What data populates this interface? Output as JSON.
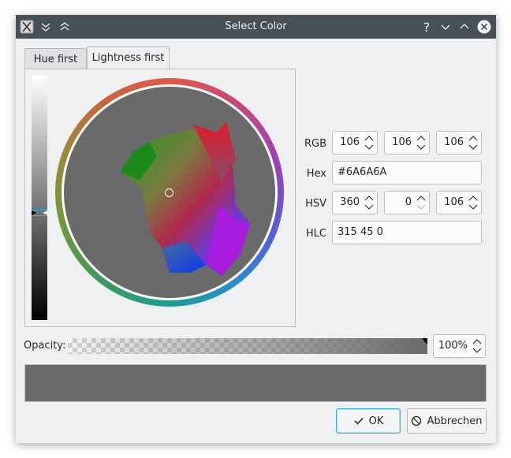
{
  "window": {
    "title": "Select Color",
    "app_icon": "x-app-icon",
    "left_buttons": [
      "chevrons-down-icon",
      "chevrons-up-icon"
    ],
    "right_buttons": [
      "help-icon",
      "minimize-icon",
      "maximize-icon",
      "close-icon"
    ],
    "help_glyph": "?"
  },
  "tabs": [
    {
      "label": "Hue first",
      "active": false
    },
    {
      "label": "Lightness first",
      "active": true
    }
  ],
  "fields": {
    "rgb_label": "RGB",
    "rgb": [
      "106",
      "106",
      "106"
    ],
    "hex_label": "Hex",
    "hex": "#6A6A6A",
    "hsv_label": "HSV",
    "hsv": [
      "360",
      "0",
      "106"
    ],
    "hlc_label": "HLC",
    "hlc": "315 45 0"
  },
  "opacity": {
    "label": "Opacity:",
    "value": "100%"
  },
  "preview": {
    "color": "#6a6a6a"
  },
  "buttons": {
    "ok": "OK",
    "cancel": "Abbrechen"
  },
  "colors": {
    "titlebar": "#475057",
    "accent": "#3daee9",
    "window_bg": "#eff0f1"
  }
}
